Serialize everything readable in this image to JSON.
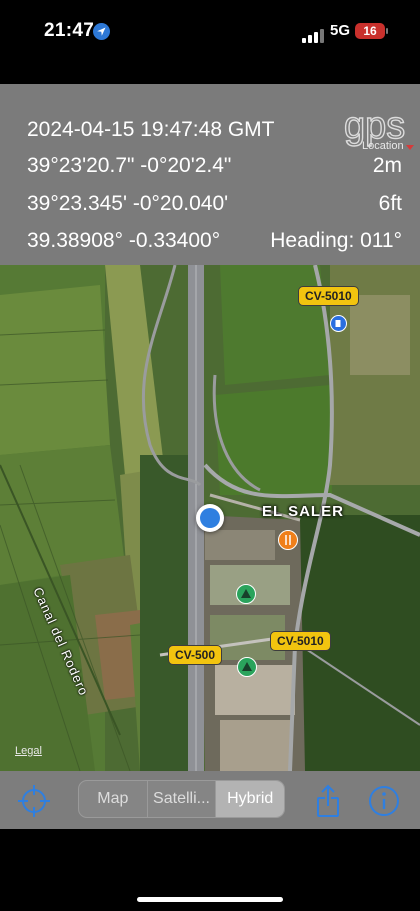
{
  "status_bar": {
    "time": "21:47",
    "network": "5G",
    "battery": "16"
  },
  "info": {
    "datetime": "2024-04-15  19:47:48 GMT",
    "dms": "39°23'20.7\" -0°20'2.4\"",
    "accuracy_m": "2m",
    "ddm": "39°23.345' -0°20.040'",
    "accuracy_ft": "6ft",
    "decimal": "39.38908° -0.33400°",
    "heading": "Heading: 011°",
    "logo_text": "gps",
    "logo_sub": "Location"
  },
  "map": {
    "place_label": "EL SALER",
    "canal_label": "Canal del Rodero",
    "road_badges": [
      "CV-5010",
      "CV-5010",
      "CV-500"
    ],
    "legal": "Legal"
  },
  "toolbar": {
    "segments": [
      {
        "label": "Map",
        "selected": false
      },
      {
        "label": "Satelli...",
        "selected": false
      },
      {
        "label": "Hybrid",
        "selected": true
      }
    ]
  },
  "colors": {
    "accent": "#2f7fe0",
    "panel_bg": "#7b7b7b",
    "badge_yellow": "#f2c40f",
    "battery_red": "#c9302c"
  }
}
